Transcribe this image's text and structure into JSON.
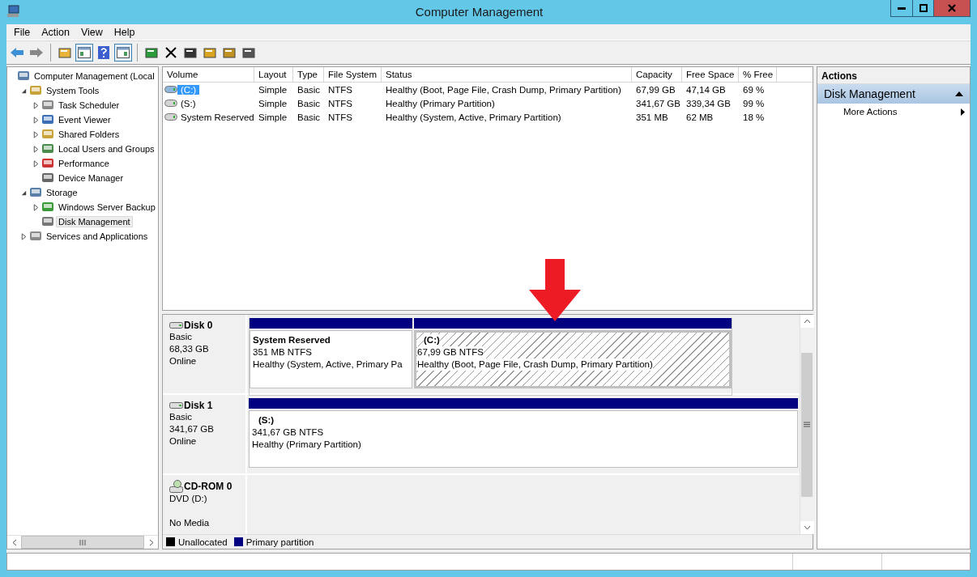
{
  "window": {
    "title": "Computer Management"
  },
  "menu": [
    "File",
    "Action",
    "View",
    "Help"
  ],
  "toolbar": [
    {
      "pressed": false
    },
    {
      "pressed": false
    },
    {
      "pressed": false
    },
    {
      "pressed": true
    },
    {
      "pressed": false
    },
    {
      "pressed": true
    },
    {
      "pressed": false
    },
    {
      "pressed": false
    },
    {
      "pressed": false
    },
    {
      "pressed": false
    },
    {
      "pressed": false
    },
    {
      "pressed": false
    }
  ],
  "tree": [
    {
      "label": "Computer Management (Local",
      "selected": false,
      "children": [
        {
          "label": "System Tools",
          "expanded": true,
          "selected": false,
          "children": [
            {
              "label": "Task Scheduler",
              "expanded": false,
              "selected": false
            },
            {
              "label": "Event Viewer",
              "expanded": false,
              "selected": false
            },
            {
              "label": "Shared Folders",
              "expanded": false,
              "selected": false
            },
            {
              "label": "Local Users and Groups",
              "expanded": false,
              "selected": false
            },
            {
              "label": "Performance",
              "expanded": false,
              "selected": false
            },
            {
              "label": "Device Manager",
              "selected": false
            }
          ]
        },
        {
          "label": "Storage",
          "expanded": true,
          "selected": false,
          "children": [
            {
              "label": "Windows Server Backup",
              "expanded": false,
              "selected": false
            },
            {
              "label": "Disk Management",
              "selected": true
            }
          ]
        },
        {
          "label": "Services and Applications",
          "expanded": false,
          "selected": false
        }
      ]
    }
  ],
  "volumes": {
    "columns": [
      "Volume",
      "Layout",
      "Type",
      "File System",
      "Status",
      "Capacity",
      "Free Space",
      "% Free"
    ],
    "rows": [
      {
        "selected": true,
        "cells": [
          "(C:)",
          "Simple",
          "Basic",
          "NTFS",
          "Healthy (Boot, Page File, Crash Dump, Primary Partition)",
          "67,99 GB",
          "47,14 GB",
          "69 %"
        ]
      },
      {
        "selected": false,
        "cells": [
          "(S:)",
          "Simple",
          "Basic",
          "NTFS",
          "Healthy (Primary Partition)",
          "341,67 GB",
          "339,34 GB",
          "99 %"
        ]
      },
      {
        "selected": false,
        "cells": [
          "System Reserved",
          "Simple",
          "Basic",
          "NTFS",
          "Healthy (System, Active, Primary Partition)",
          "351 MB",
          "62 MB",
          "18 %"
        ]
      }
    ]
  },
  "disks": [
    {
      "kind": "disk",
      "name": "Disk 0",
      "type": "Basic",
      "size": "68,33 GB",
      "status": "Online",
      "partitions": [
        {
          "name": "System Reserved",
          "size": "351 MB NTFS",
          "status": "Healthy (System, Active, Primary Pa",
          "selected": false
        },
        {
          "name": "(C:)",
          "size": "67,99 GB NTFS",
          "status": "Healthy (Boot, Page File, Crash Dump, Primary Partition)",
          "selected": true
        }
      ]
    },
    {
      "kind": "disk",
      "name": "Disk 1",
      "type": "Basic",
      "size": "341,67 GB",
      "status": "Online",
      "partitions": [
        {
          "name": "(S:)",
          "size": "341,67 GB NTFS",
          "status": "Healthy (Primary Partition)",
          "selected": false
        }
      ]
    },
    {
      "kind": "cdrom",
      "name": "CD-ROM 0",
      "type": "DVD (D:)",
      "status": "No Media"
    }
  ],
  "legend": [
    {
      "label": "Unallocated",
      "color": "#000000"
    },
    {
      "label": "Primary partition",
      "color": "#000080"
    }
  ],
  "actions": {
    "title": "Actions",
    "section": {
      "label": "Disk Management",
      "expanded": true
    },
    "items": [
      "More Actions"
    ]
  }
}
